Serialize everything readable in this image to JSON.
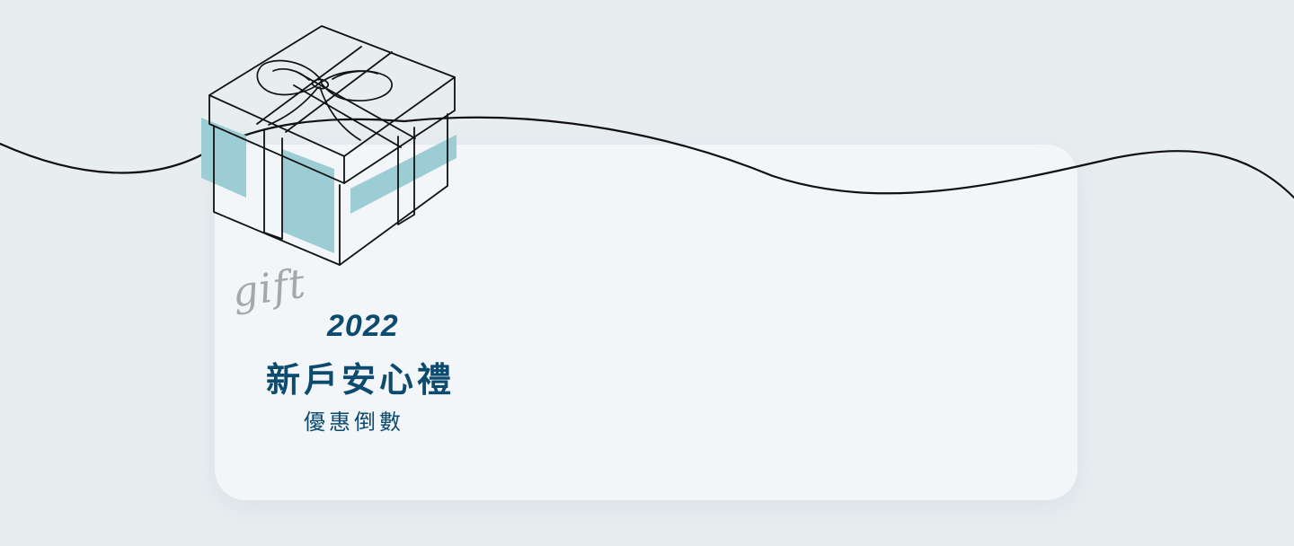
{
  "promo": {
    "script_word": "gift",
    "year": "2022",
    "title": "新戶安心禮",
    "subtitle": "優惠倒數"
  },
  "colors": {
    "page_background": "#e8edf0",
    "card_background": "#f2f6f8",
    "accent_teal": "#9dcdd4",
    "text_navy": "#0c4a6e",
    "script_gray": "#a7a7a7",
    "line_dark": "#111111"
  },
  "icons": {
    "gift_box": "gift-box-icon",
    "ribbon_bow": "ribbon-bow-icon",
    "wave_line": "wave-line-icon"
  }
}
